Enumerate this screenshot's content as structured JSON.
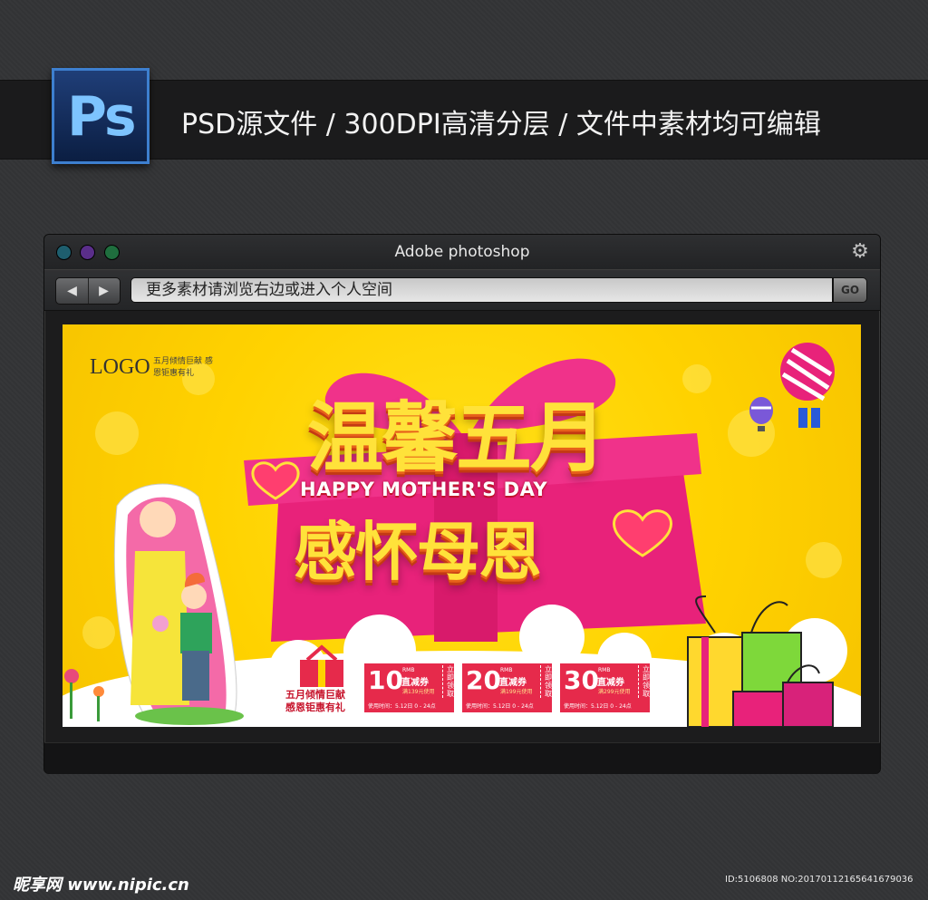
{
  "header": {
    "app_icon": "photoshop-icon",
    "app_icon_text": "Ps",
    "title": "PSD源文件 / 300DPI高清分层  / 文件中素材均可编辑"
  },
  "window": {
    "title": "Adobe photoshop",
    "controls": [
      "close-dot",
      "minimize-dot",
      "maximize-dot"
    ],
    "settings_icon": "gear-icon",
    "back_icon": "chevron-left-icon",
    "forward_icon": "chevron-right-icon",
    "address_text": "更多素材请浏览右边或进入个人空间",
    "go_label": "GO"
  },
  "banner": {
    "logo": "LOGO",
    "logo_sub": "五月倾情巨献 感恩钜惠有礼",
    "headline_1": "温馨五月",
    "headline_en": "HAPPY MOTHER'S DAY",
    "headline_2": "感怀母恩",
    "gift_caption_1": "五月倾情巨献",
    "gift_caption_2": "感恩钜惠有礼",
    "coupons": [
      {
        "amount": "10",
        "currency": "RMB",
        "title": "直减券",
        "condition": "满139元使用",
        "time": "使用时间：5.12日 0 - 24点",
        "claim": "立即领取"
      },
      {
        "amount": "20",
        "currency": "RMB",
        "title": "直减券",
        "condition": "满199元使用",
        "time": "使用时间：5.12日 0 - 24点",
        "claim": "立即领取"
      },
      {
        "amount": "30",
        "currency": "RMB",
        "title": "直减券",
        "condition": "满299元使用",
        "time": "使用时间：5.12日 0 - 24点",
        "claim": "立即领取"
      }
    ],
    "colors": {
      "background": "#ffd200",
      "accent": "#e8227a",
      "coupon": "#e62a4b"
    }
  },
  "watermark": {
    "site": "昵享网 www.nipic.cn",
    "id": "ID:5106808 NO:20170112165641679036"
  }
}
